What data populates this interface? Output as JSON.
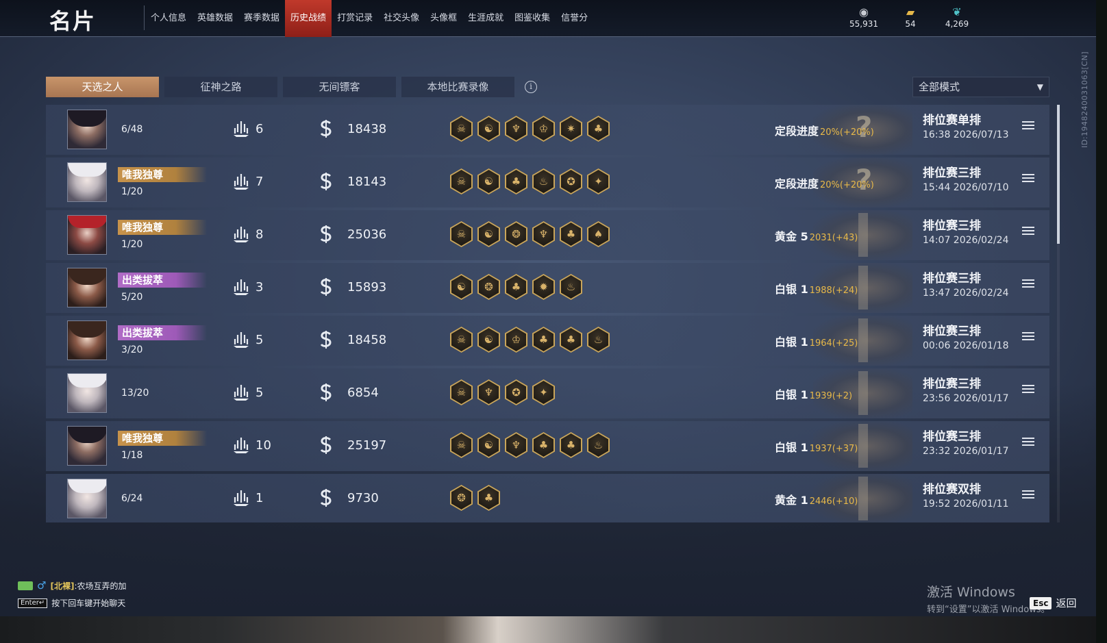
{
  "topbar": {
    "brand": "名片",
    "nav": [
      "个人信息",
      "英雄数据",
      "赛季数据",
      "历史战绩",
      "打赏记录",
      "社交头像",
      "头像框",
      "生涯成就",
      "图鉴收集",
      "信誉分"
    ],
    "active_nav": "历史战绩",
    "currencies": [
      {
        "icon": "coin-stack-icon",
        "value": "55,931"
      },
      {
        "icon": "gold-ticket-icon",
        "value": "54"
      },
      {
        "icon": "feather-icon",
        "value": "4,269"
      }
    ]
  },
  "side_id": "ID:1948240031063[CN]",
  "tabs": [
    "天选之人",
    "征神之路",
    "无间镖客",
    "本地比赛录像"
  ],
  "active_tab": "天选之人",
  "mode_select": {
    "value": "全部模式"
  },
  "matches": [
    {
      "title": "",
      "rank": "6/48",
      "kills": "6",
      "score": "18438",
      "hexes": [
        "☠",
        "☯",
        "♆",
        "♔",
        "✷",
        "♣"
      ],
      "rank_label": "定段进度",
      "rank_delta": "20%(+20%)",
      "match_type": "排位赛单排",
      "time": "16:38  2026/07/13",
      "emblem": "?"
    },
    {
      "title": "唯我独尊",
      "title_style": "gold",
      "rank": "1/20",
      "kills": "7",
      "score": "18143",
      "hexes": [
        "☠",
        "☯",
        "♣",
        "♨",
        "✪",
        "✦"
      ],
      "rank_label": "定段进度",
      "rank_delta": "20%(+20%)",
      "match_type": "排位赛三排",
      "time": "15:44  2026/07/10",
      "emblem": "?"
    },
    {
      "title": "唯我独尊",
      "title_style": "gold",
      "rank": "1/20",
      "kills": "8",
      "score": "25036",
      "hexes": [
        "☠",
        "☯",
        "❂",
        "♆",
        "♣",
        "♠"
      ],
      "rank_label": "黄金 5",
      "rank_delta": "2031(+43)",
      "match_type": "排位赛三排",
      "time": "14:07  2026/02/24",
      "emblem": ""
    },
    {
      "title": "出类拔萃",
      "title_style": "purple",
      "rank": "5/20",
      "kills": "3",
      "score": "15893",
      "hexes": [
        "☯",
        "❂",
        "♣",
        "✹",
        "♨"
      ],
      "rank_label": "白银 1",
      "rank_delta": "1988(+24)",
      "match_type": "排位赛三排",
      "time": "13:47  2026/02/24",
      "emblem": ""
    },
    {
      "title": "出类拔萃",
      "title_style": "purple",
      "rank": "3/20",
      "kills": "5",
      "score": "18458",
      "hexes": [
        "☠",
        "☯",
        "♔",
        "♣",
        "♣",
        "♨"
      ],
      "rank_label": "白银 1",
      "rank_delta": "1964(+25)",
      "match_type": "排位赛三排",
      "time": "00:06  2026/01/18",
      "emblem": ""
    },
    {
      "title": "",
      "rank": "13/20",
      "kills": "5",
      "score": "6854",
      "hexes": [
        "☠",
        "♆",
        "✪",
        "✦"
      ],
      "rank_label": "白银 1",
      "rank_delta": "1939(+2)",
      "match_type": "排位赛三排",
      "time": "23:56  2026/01/17",
      "emblem": ""
    },
    {
      "title": "唯我独尊",
      "title_style": "gold",
      "rank": "1/18",
      "kills": "10",
      "score": "25197",
      "hexes": [
        "☠",
        "☯",
        "♆",
        "♣",
        "♣",
        "♨"
      ],
      "rank_label": "白银 1",
      "rank_delta": "1937(+37)",
      "match_type": "排位赛三排",
      "time": "23:32  2026/01/17",
      "emblem": ""
    },
    {
      "title": "",
      "rank": "6/24",
      "kills": "1",
      "score": "9730",
      "hexes": [
        "❂",
        "♣"
      ],
      "rank_label": "黄金 1",
      "rank_delta": "2446(+10)",
      "match_type": "排位赛双排",
      "time": "19:52  2026/01/11",
      "emblem": ""
    }
  ],
  "chat": {
    "nick": "[北裸]",
    "message": ":农场互弄的加",
    "enter_key": "Enter↵",
    "hint": "按下回车键开始聊天"
  },
  "watermark": {
    "line1": "激活 Windows",
    "line2": "转到“设置”以激活 Windows。"
  },
  "esc": {
    "key": "Esc",
    "label": "返回"
  }
}
